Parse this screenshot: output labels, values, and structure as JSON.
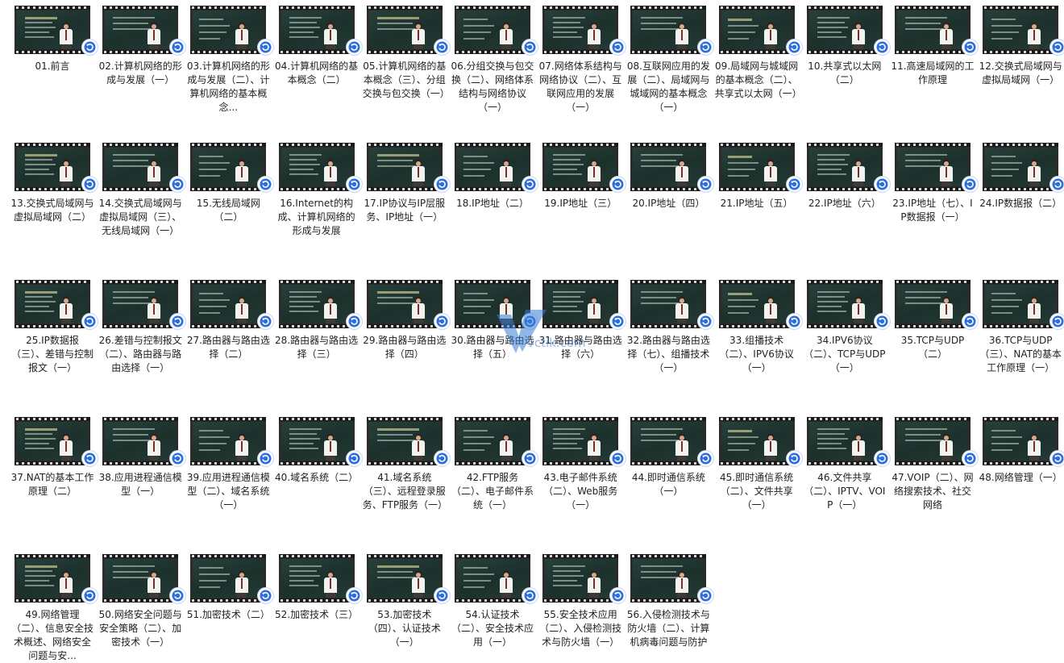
{
  "watermark": {
    "text": "vctik.com"
  },
  "icons": {
    "badge": "refresh-arrow-icon",
    "thumbnail": "video-film-icon"
  },
  "colors": {
    "badge_blue": "#2f6fdc",
    "thumb_board": "#27403b",
    "caption": "#222222"
  },
  "videos": [
    {
      "label": "01.前言"
    },
    {
      "label": "02.计算机网络的形成与发展（一）"
    },
    {
      "label": "03.计算机网络的形成与发展（二）、计算机网络的基本概念..."
    },
    {
      "label": "04.计算机网络的基本概念（二）"
    },
    {
      "label": "05.计算机网络的基本概念（三）、分组交换与包交换（一）"
    },
    {
      "label": "06.分组交换与包交换（二）、网络体系结构与网络协议（一）"
    },
    {
      "label": "07.网络体系结构与网络协议（二）、互联网应用的发展（一）"
    },
    {
      "label": "08.互联网应用的发展（二）、局域网与城域网的基本概念（一）"
    },
    {
      "label": "09.局域网与城域网的基本概念（二）、共享式以太网（一）"
    },
    {
      "label": "10.共享式以太网（二）"
    },
    {
      "label": "11.高速局域网的工作原理"
    },
    {
      "label": "12.交换式局域网与虚拟局域网（一）"
    },
    {
      "label": "13.交换式局域网与虚拟局域网（二）"
    },
    {
      "label": "14.交换式局域网与虚拟局域网（三）、无线局域网（一）"
    },
    {
      "label": "15.无线局域网（二）"
    },
    {
      "label": "16.Internet的构成、计算机网络的形成与发展"
    },
    {
      "label": "17.IP协议与IP层服务、IP地址（一）"
    },
    {
      "label": "18.IP地址（二）"
    },
    {
      "label": "19.IP地址（三）"
    },
    {
      "label": "20.IP地址（四）"
    },
    {
      "label": "21.IP地址（五）"
    },
    {
      "label": "22.IP地址（六）"
    },
    {
      "label": "23.IP地址（七）、IP数据报（一）"
    },
    {
      "label": "24.IP数据报（二）"
    },
    {
      "label": "25.IP数据报（三）、差错与控制报文（一）"
    },
    {
      "label": "26.差错与控制报文（二）、路由器与路由选择（一）"
    },
    {
      "label": "27.路由器与路由选择（二）"
    },
    {
      "label": "28.路由器与路由选择（三）"
    },
    {
      "label": "29.路由器与路由选择（四）"
    },
    {
      "label": "30.路由器与路由选择（五）"
    },
    {
      "label": "31.路由器与路由选择（六）"
    },
    {
      "label": "32.路由器与路由选择（七）、组播技术（一）"
    },
    {
      "label": "33.组播技术（二）、IPV6协议（一）"
    },
    {
      "label": "34.IPV6协议（二）、TCP与UDP（一）"
    },
    {
      "label": "35.TCP与UDP（二）"
    },
    {
      "label": "36.TCP与UDP（三）、NAT的基本工作原理（一）"
    },
    {
      "label": "37.NAT的基本工作原理（二）"
    },
    {
      "label": "38.应用进程通信模型（一）"
    },
    {
      "label": "39.应用进程通信模型（二）、域名系统（一）"
    },
    {
      "label": "40.域名系统（二）"
    },
    {
      "label": "41.域名系统（三）、远程登录服务、FTP服务（一）"
    },
    {
      "label": "42.FTP服务（二）、电子邮件系统（一）"
    },
    {
      "label": "43.电子邮件系统（二）、Web服务（一）"
    },
    {
      "label": "44.即时通信系统（一）"
    },
    {
      "label": "45.即时通信系统（二）、文件共享（一）"
    },
    {
      "label": "46.文件共享（二）、IPTV、VOIP（一）"
    },
    {
      "label": "47.VOIP（二）、网络搜索技术、社交网络"
    },
    {
      "label": "48.网络管理（一）"
    },
    {
      "label": "49.网络管理（二）、信息安全技术概述、网络安全问题与安..."
    },
    {
      "label": "50.网络安全问题与安全策略（二）、加密技术（一）"
    },
    {
      "label": "51.加密技术（二）"
    },
    {
      "label": "52.加密技术（三）"
    },
    {
      "label": "53.加密技术（四）、认证技术（一）"
    },
    {
      "label": "54.认证技术（二）、安全技术应用（一）"
    },
    {
      "label": "55.安全技术应用（二）、入侵检测技术与防火墙（一）"
    },
    {
      "label": "56.入侵检测技术与防火墙（二）、计算机病毒问题与防护"
    }
  ]
}
